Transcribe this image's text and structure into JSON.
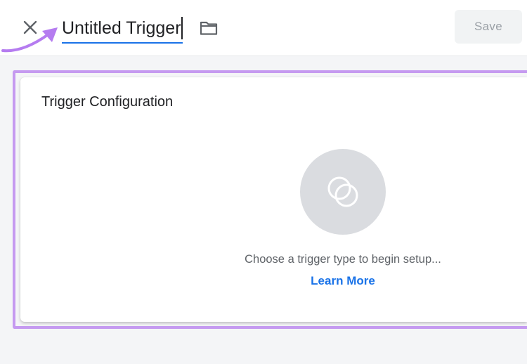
{
  "header": {
    "title": "Untitled Trigger",
    "save_label": "Save",
    "close_icon": "close-icon",
    "folder_icon": "folder-icon"
  },
  "card": {
    "title": "Trigger Configuration",
    "empty_icon": "trigger-type-icon",
    "hint": "Choose a trigger type to begin setup...",
    "learn_more": "Learn More"
  },
  "colors": {
    "accent": "#1a73e8",
    "annotation": "#b57cf0",
    "placeholder_circle": "#dadce0"
  }
}
